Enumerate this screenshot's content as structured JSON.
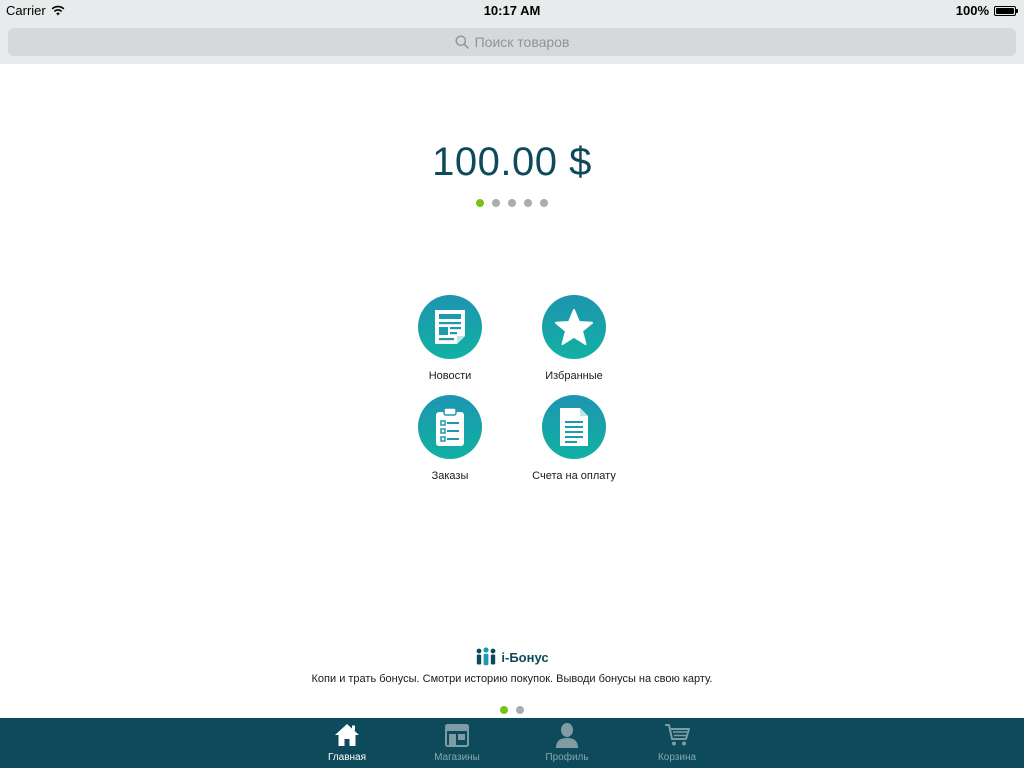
{
  "status_bar": {
    "carrier": "Carrier",
    "time": "10:17 AM",
    "battery": "100%",
    "icons": [
      "wifi-icon",
      "battery-icon"
    ]
  },
  "search": {
    "placeholder": "Поиск товаров",
    "icon": "search-icon"
  },
  "balance": {
    "amount": "100.00 $",
    "pager_count": 5,
    "pager_active": 0
  },
  "menu": [
    {
      "label": "Новости",
      "icon": "newspaper-icon"
    },
    {
      "label": "Избранные",
      "icon": "star-icon"
    },
    {
      "label": "Заказы",
      "icon": "clipboard-icon"
    },
    {
      "label": "Счета на оплату",
      "icon": "invoice-document-icon"
    }
  ],
  "promo": {
    "brand": "i-Бонус",
    "tagline": "Копи и трать бонусы. Смотри историю покупок. Выводи бонусы на свою карту.",
    "pager_count": 2,
    "pager_active": 0
  },
  "tab_bar": {
    "items": [
      {
        "label": "Главная",
        "icon": "home-icon",
        "active": true
      },
      {
        "label": "Магазины",
        "icon": "store-icon",
        "active": false
      },
      {
        "label": "Профиль",
        "icon": "profile-icon",
        "active": false
      },
      {
        "label": "Корзина",
        "icon": "cart-icon",
        "active": false
      }
    ]
  },
  "colors": {
    "accent_dark": "#0d4a5b",
    "accent_gradient_top": "#1e95b0",
    "accent_gradient_bottom": "#12b0a3",
    "pager_active": "#78c31b",
    "pager_inactive": "#a9adb0"
  }
}
